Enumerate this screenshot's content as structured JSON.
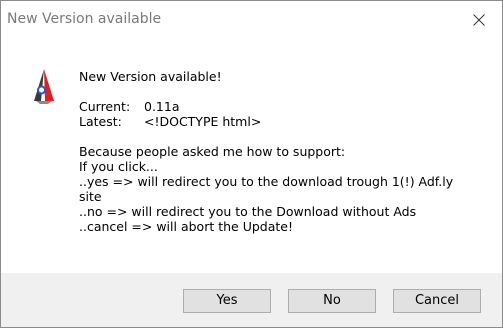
{
  "window": {
    "title": "New Version available",
    "close_icon": "close-icon"
  },
  "app_icon": "rocket-icon",
  "message": {
    "heading": "New Version available!",
    "current_label": "Current:",
    "current_value": "0.11a",
    "latest_label": "Latest:",
    "latest_value": "<!DOCTYPE html>",
    "line_because": "Because people asked me how to support:",
    "line_if": "If you click...",
    "line_yes_1": "..yes => will redirect you to the download trough 1(!) Adf.ly",
    "line_yes_2": "site",
    "line_no": "..no => will redirect you to the Download without Ads",
    "line_cancel": "..cancel => will abort the Update!"
  },
  "buttons": {
    "yes": "Yes",
    "no": "No",
    "cancel": "Cancel"
  }
}
